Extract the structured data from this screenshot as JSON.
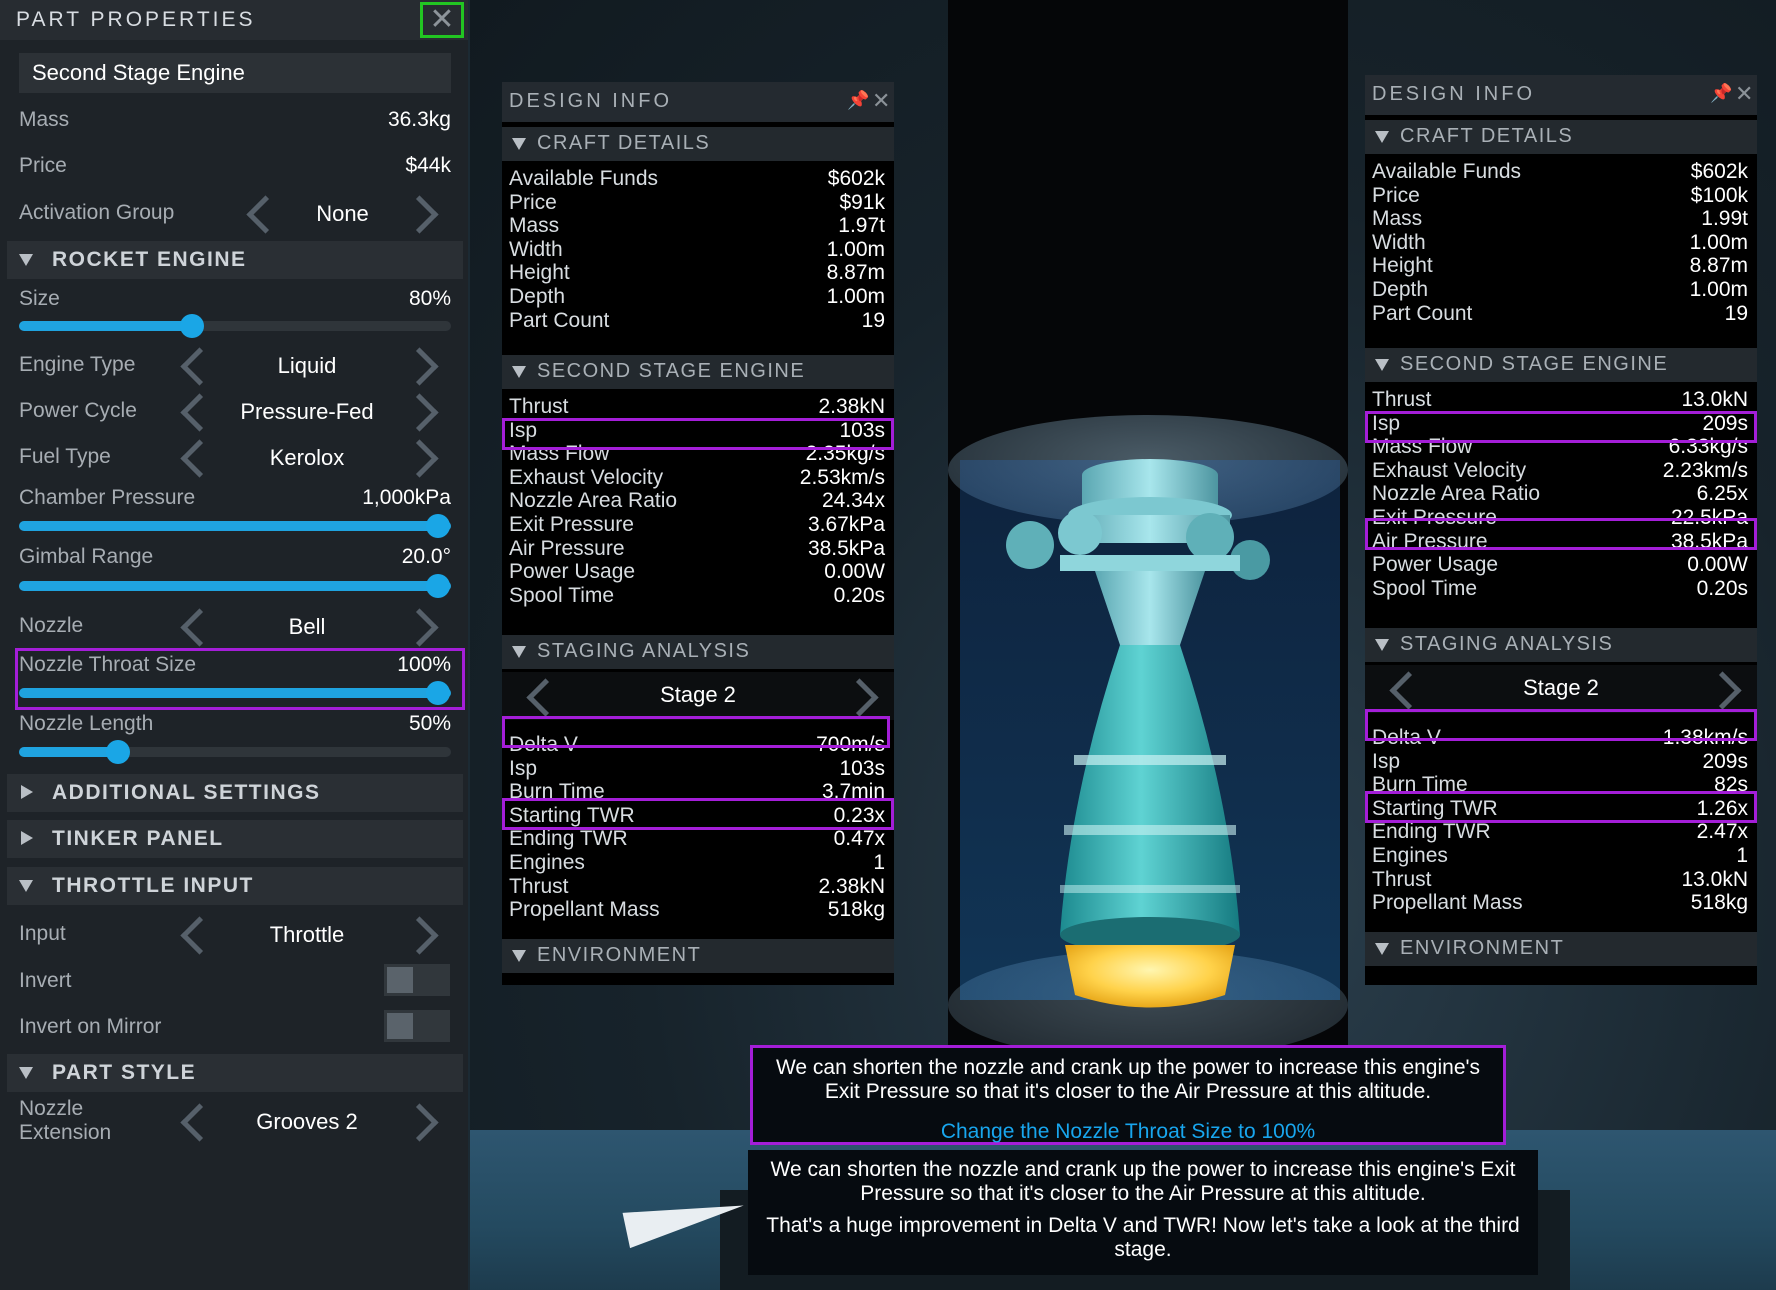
{
  "part_properties": {
    "title": "PART PROPERTIES",
    "part_name": "Second Stage Engine",
    "mass": {
      "label": "Mass",
      "value": "36.3kg"
    },
    "price": {
      "label": "Price",
      "value": "$44k"
    },
    "activation_group": {
      "label": "Activation Group",
      "value": "None"
    },
    "rocket_engine": {
      "header": "ROCKET ENGINE",
      "size": {
        "label": "Size",
        "value": "80%",
        "level": 0.4
      },
      "engine_type": {
        "label": "Engine Type",
        "value": "Liquid"
      },
      "power_cycle": {
        "label": "Power Cycle",
        "value": "Pressure-Fed"
      },
      "fuel_type": {
        "label": "Fuel Type",
        "value": "Kerolox"
      },
      "chamber_pressure": {
        "label": "Chamber Pressure",
        "value": "1,000kPa",
        "level": 1.0
      },
      "gimbal_range": {
        "label": "Gimbal Range",
        "value": "20.0°",
        "level": 1.0
      },
      "nozzle": {
        "label": "Nozzle",
        "value": "Bell"
      },
      "nozzle_throat_size": {
        "label": "Nozzle Throat Size",
        "value": "100%",
        "level": 1.0
      },
      "nozzle_length": {
        "label": "Nozzle Length",
        "value": "50%",
        "level": 0.23
      }
    },
    "additional_settings": "ADDITIONAL SETTINGS",
    "tinker_panel": "TINKER PANEL",
    "throttle_input": {
      "header": "THROTTLE INPUT",
      "input": {
        "label": "Input",
        "value": "Throttle"
      },
      "invert": {
        "label": "Invert"
      },
      "invert_on_mirror": {
        "label": "Invert on Mirror"
      }
    },
    "part_style": {
      "header": "PART STYLE",
      "nozzle_extension_line1": "Nozzle",
      "nozzle_extension_line2": "Extension",
      "nozzle_extension_value": "Grooves 2"
    }
  },
  "design_info_left": {
    "title": "DESIGN INFO",
    "craft_details": {
      "header": "CRAFT DETAILS",
      "rows": [
        {
          "label": "Available Funds",
          "value": "$602k"
        },
        {
          "label": "Price",
          "value": "$91k"
        },
        {
          "label": "Mass",
          "value": "1.97t"
        },
        {
          "label": "Width",
          "value": "1.00m"
        },
        {
          "label": "Height",
          "value": "8.87m"
        },
        {
          "label": "Depth",
          "value": "1.00m"
        },
        {
          "label": "Part Count",
          "value": "19"
        }
      ]
    },
    "engine": {
      "header": "SECOND STAGE ENGINE",
      "rows": [
        {
          "label": "Thrust",
          "value": "2.38kN"
        },
        {
          "label": "Isp",
          "value": "103s"
        },
        {
          "label": "Mass Flow",
          "value": "2.35kg/s"
        },
        {
          "label": "Exhaust Velocity",
          "value": "2.53km/s"
        },
        {
          "label": "Nozzle Area Ratio",
          "value": "24.34x"
        },
        {
          "label": "Exit Pressure",
          "value": "3.67kPa"
        },
        {
          "label": "Air Pressure",
          "value": "38.5kPa"
        },
        {
          "label": "Power Usage",
          "value": "0.00W"
        },
        {
          "label": "Spool Time",
          "value": "0.20s"
        }
      ]
    },
    "staging": {
      "header": "STAGING ANALYSIS",
      "stage": "Stage 2",
      "rows": [
        {
          "label": "Delta V",
          "value": "700m/s"
        },
        {
          "label": "Isp",
          "value": "103s"
        },
        {
          "label": "Burn Time",
          "value": "3.7min"
        },
        {
          "label": "Starting TWR",
          "value": "0.23x"
        },
        {
          "label": "Ending TWR",
          "value": "0.47x"
        },
        {
          "label": "Engines",
          "value": "1"
        },
        {
          "label": "Thrust",
          "value": "2.38kN"
        },
        {
          "label": "Propellant Mass",
          "value": "518kg"
        }
      ]
    },
    "environment": "ENVIRONMENT"
  },
  "design_info_right": {
    "title": "DESIGN INFO",
    "craft_details": {
      "header": "CRAFT DETAILS",
      "rows": [
        {
          "label": "Available Funds",
          "value": "$602k"
        },
        {
          "label": "Price",
          "value": "$100k"
        },
        {
          "label": "Mass",
          "value": "1.99t"
        },
        {
          "label": "Width",
          "value": "1.00m"
        },
        {
          "label": "Height",
          "value": "8.87m"
        },
        {
          "label": "Depth",
          "value": "1.00m"
        },
        {
          "label": "Part Count",
          "value": "19"
        }
      ]
    },
    "engine": {
      "header": "SECOND STAGE ENGINE",
      "rows": [
        {
          "label": "Thrust",
          "value": "13.0kN"
        },
        {
          "label": "Isp",
          "value": "209s"
        },
        {
          "label": "Mass Flow",
          "value": "6.33kg/s"
        },
        {
          "label": "Exhaust Velocity",
          "value": "2.23km/s"
        },
        {
          "label": "Nozzle Area Ratio",
          "value": "6.25x"
        },
        {
          "label": "Exit Pressure",
          "value": "22.5kPa"
        },
        {
          "label": "Air Pressure",
          "value": "38.5kPa"
        },
        {
          "label": "Power Usage",
          "value": "0.00W"
        },
        {
          "label": "Spool Time",
          "value": "0.20s"
        }
      ]
    },
    "staging": {
      "header": "STAGING ANALYSIS",
      "stage": "Stage 2",
      "rows": [
        {
          "label": "Delta V",
          "value": "1.38km/s"
        },
        {
          "label": "Isp",
          "value": "209s"
        },
        {
          "label": "Burn Time",
          "value": "82s"
        },
        {
          "label": "Starting TWR",
          "value": "1.26x"
        },
        {
          "label": "Ending TWR",
          "value": "2.47x"
        },
        {
          "label": "Engines",
          "value": "1"
        },
        {
          "label": "Thrust",
          "value": "13.0kN"
        },
        {
          "label": "Propellant Mass",
          "value": "518kg"
        }
      ]
    },
    "environment": "ENVIRONMENT"
  },
  "tutorial": {
    "tip1_text": "We can shorten the nozzle and crank up the power to increase this engine's Exit Pressure so that it's closer to the Air Pressure at this altitude.",
    "tip1_action": "Change the Nozzle Throat Size to 100%",
    "tip2_text": "We can shorten the nozzle and crank up the power to increase this engine's Exit Pressure so that it's closer to the Air Pressure at this altitude.",
    "tip2_followup": "That's a huge improvement in Delta V and TWR! Now let's take a look at the third stage."
  },
  "colors": {
    "accent": "#1fa3e0",
    "highlight": "#a41ed8",
    "close_box": "#22c522",
    "link": "#18a6ee"
  }
}
